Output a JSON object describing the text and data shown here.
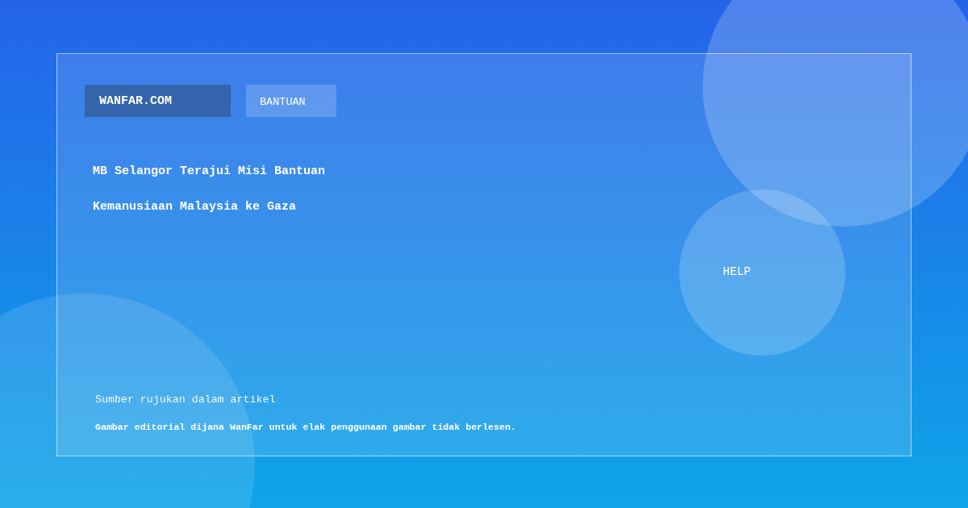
{
  "nav": {
    "brand": "WANFAR.COM",
    "items": [
      {
        "label": "BANTUAN"
      }
    ]
  },
  "headline": "MB Selangor Terajui Misi Bantuan Kemanusiaan Malaysia ke Gaza",
  "badge": {
    "label": "HELP"
  },
  "footer": {
    "source_note": "Sumber rujukan dalam artikel",
    "disclaimer": "Gambar editorial dijana WanFar untuk elak penggunaan gambar tidak berlesen."
  }
}
